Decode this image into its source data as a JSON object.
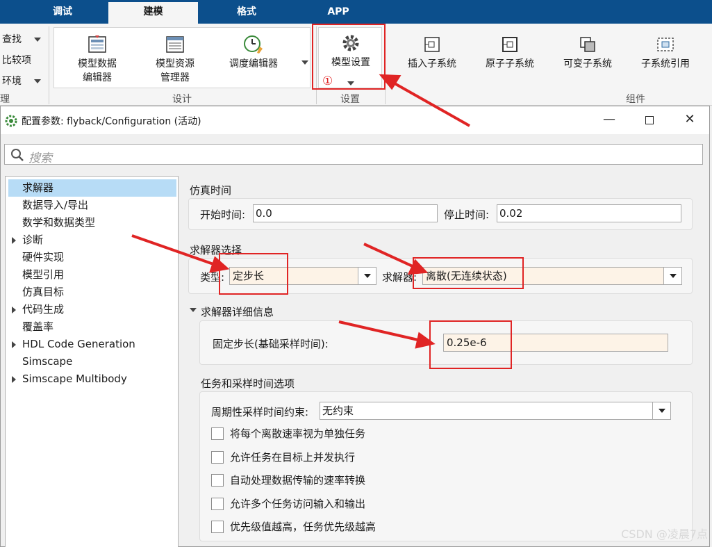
{
  "ribbon": {
    "tabs": [
      {
        "label": "调试",
        "active": false
      },
      {
        "label": "建模",
        "active": true
      },
      {
        "label": "格式",
        "active": false
      },
      {
        "label": "APP",
        "active": false
      }
    ],
    "left_items": {
      "find": "查找",
      "compare": "比较项",
      "env": "环境",
      "group_fragment": "理"
    },
    "design_tools": {
      "model_data_editor": "模型数据\n编辑器",
      "model_explorer": "模型资源\n管理器",
      "schedule_editor": "调度编辑器"
    },
    "design_group_label": "设计",
    "settings_tool": "模型设置",
    "settings_marker": "①",
    "settings_group_label": "设置",
    "component_tools": {
      "insert_subsystem": "插入子系统",
      "atomic_subsystem": "原子子系统",
      "variant_subsystem": "可变子系统",
      "subsystem_reference": "子系统引用"
    },
    "component_group_label": "组件"
  },
  "dialog": {
    "title": "配置参数: flyback/Configuration (活动)",
    "search_placeholder": "搜索",
    "tree": [
      {
        "label": "求解器",
        "selected": true,
        "expandable": false
      },
      {
        "label": "数据导入/导出",
        "selected": false,
        "expandable": false
      },
      {
        "label": "数学和数据类型",
        "selected": false,
        "expandable": false
      },
      {
        "label": "诊断",
        "selected": false,
        "expandable": true
      },
      {
        "label": "硬件实现",
        "selected": false,
        "expandable": false
      },
      {
        "label": "模型引用",
        "selected": false,
        "expandable": false
      },
      {
        "label": "仿真目标",
        "selected": false,
        "expandable": false
      },
      {
        "label": "代码生成",
        "selected": false,
        "expandable": true
      },
      {
        "label": "覆盖率",
        "selected": false,
        "expandable": false
      },
      {
        "label": "HDL Code Generation",
        "selected": false,
        "expandable": true
      },
      {
        "label": "Simscape",
        "selected": false,
        "expandable": false
      },
      {
        "label": "Simscape Multibody",
        "selected": false,
        "expandable": true
      }
    ],
    "sim_time": {
      "section": "仿真时间",
      "start_label": "开始时间:",
      "start_value": "0.0",
      "stop_label": "停止时间:",
      "stop_value": "0.02"
    },
    "solver_select": {
      "section": "求解器选择",
      "type_label": "类型:",
      "type_value": "定步长",
      "solver_label": "求解器:",
      "solver_value": "离散(无连续状态)"
    },
    "solver_details": {
      "section": "求解器详细信息",
      "fixed_step_label": "固定步长(基础采样时间):",
      "fixed_step_value": "0.25e-6"
    },
    "tasking": {
      "section": "任务和采样时间选项",
      "periodic_label": "周期性采样时间约束:",
      "periodic_value": "无约束",
      "options": [
        "将每个离散速率视为单独任务",
        "允许任务在目标上并发执行",
        "自动处理数据传输的速率转换",
        "允许多个任务访问输入和输出",
        "优先级值越高，任务优先级越高"
      ]
    }
  },
  "watermark": "CSDN @凌晨7点",
  "colors": {
    "tabbar": "#0c4f8c",
    "selection": "#b7dcf6",
    "highlight_red": "#e02424",
    "field_tint": "#fdf3e7"
  }
}
